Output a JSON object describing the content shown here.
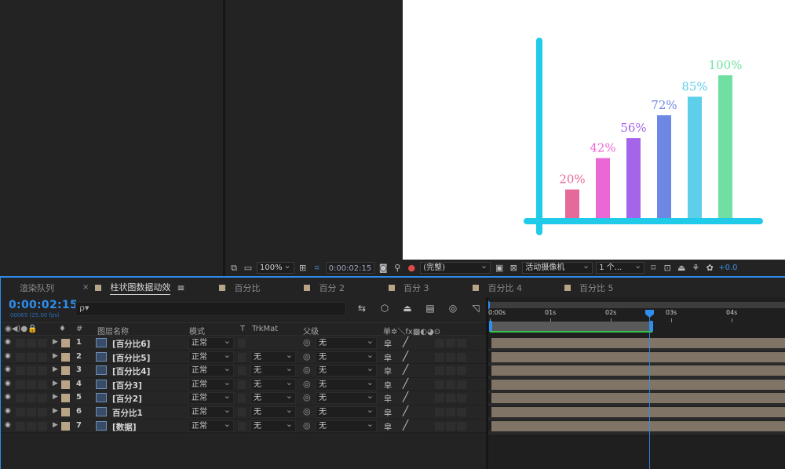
{
  "viewer_toolbar": {
    "zoom": "100%",
    "time": "0:00:02:15",
    "resolution": "(完整)",
    "camera": "活动摄像机",
    "views": "1 个...",
    "exposure": "+0.0"
  },
  "tabs": [
    {
      "label": "渲染队列",
      "active": false
    },
    {
      "label": "柱状图数据动效",
      "active": true
    },
    {
      "label": "百分比",
      "active": false
    },
    {
      "label": "百分 2",
      "active": false
    },
    {
      "label": "百分 3",
      "active": false
    },
    {
      "label": "百分比 4",
      "active": false
    },
    {
      "label": "百分比 5",
      "active": false
    }
  ],
  "timeline": {
    "timecode": "0:00:02:15",
    "frame_info": "00065 (25.00 fps)",
    "search_placeholder": "ρ▾",
    "ruler_labels": [
      "0:00s",
      "01s",
      "02s",
      "03s",
      "04s"
    ]
  },
  "columns": {
    "switches": "◉◀)●🔒",
    "label_col": "♦",
    "num_col": "#",
    "layer_name": "图层名称",
    "mode": "模式",
    "t": "T",
    "trkmat": "TrkMat",
    "parent": "父级",
    "sw": "单✲＼fx▩◐◕⊙"
  },
  "layers": [
    {
      "num": "1",
      "name": "[百分比6]",
      "mode": "正常",
      "trkmat": "",
      "parent": "无"
    },
    {
      "num": "2",
      "name": "[百分比5]",
      "mode": "正常",
      "trkmat": "无",
      "parent": "无"
    },
    {
      "num": "3",
      "name": "[百分比4]",
      "mode": "正常",
      "trkmat": "无",
      "parent": "无"
    },
    {
      "num": "4",
      "name": "[百分3]",
      "mode": "正常",
      "trkmat": "无",
      "parent": "无"
    },
    {
      "num": "5",
      "name": "[百分2]",
      "mode": "正常",
      "trkmat": "无",
      "parent": "无"
    },
    {
      "num": "6",
      "name": "百分比1",
      "mode": "正常",
      "trkmat": "无",
      "parent": "无"
    },
    {
      "num": "7",
      "name": "[数据]",
      "mode": "正常",
      "trkmat": "无",
      "parent": "无"
    }
  ],
  "chart_data": {
    "type": "bar",
    "categories": [
      "",
      "",
      "",
      "",
      "",
      ""
    ],
    "values": [
      20,
      42,
      56,
      72,
      85,
      100
    ],
    "value_labels": [
      "20%",
      "42%",
      "56%",
      "72%",
      "85%",
      "100%"
    ],
    "colors": [
      "#e5699a",
      "#ea67d6",
      "#a565ea",
      "#6c88e4",
      "#5ecfe8",
      "#6fe0a1"
    ],
    "axis_color": "#1fcbe9",
    "ylim": [
      0,
      100
    ]
  }
}
